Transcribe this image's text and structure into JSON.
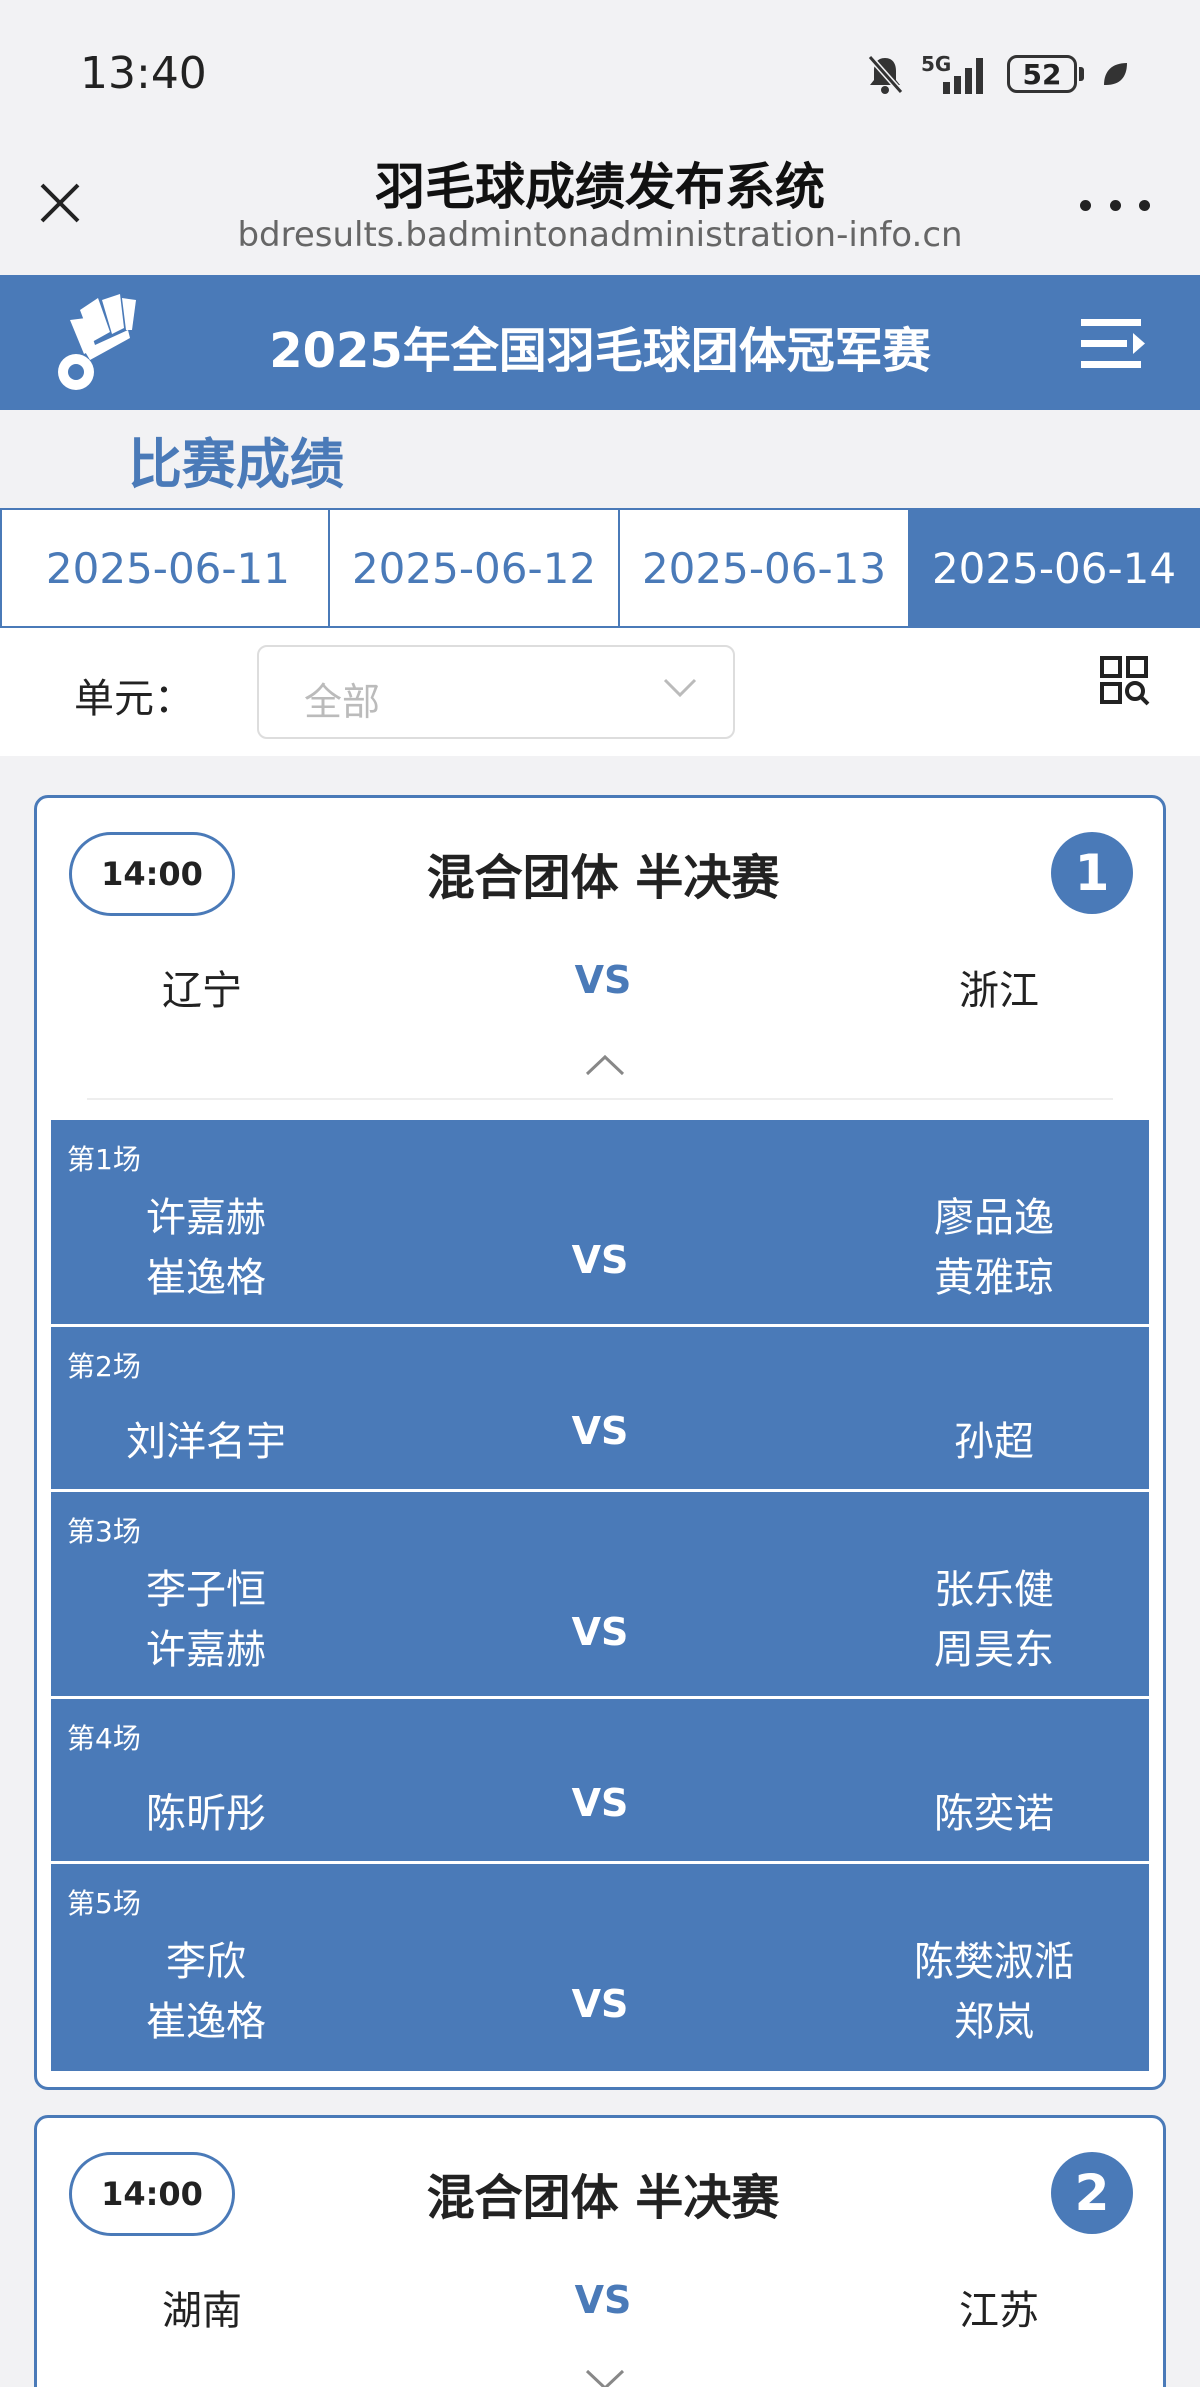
{
  "status_bar": {
    "time": "13:40",
    "network": "5G",
    "battery": "52"
  },
  "browser": {
    "title": "羽毛球成绩发布系统",
    "url": "bdresults.badmintonadministration-info.cn"
  },
  "site": {
    "title": "2025年全国羽毛球团体冠军赛"
  },
  "page": {
    "heading": "比赛成绩"
  },
  "dates": [
    "2025-06-11",
    "2025-06-12",
    "2025-06-13",
    "2025-06-14"
  ],
  "active_date": "2025-06-14",
  "filter": {
    "label": "单元：",
    "value": "全部"
  },
  "matches": [
    {
      "time": "14:00",
      "event": "混合团体 半决赛",
      "number": "1",
      "team_left": "辽宁",
      "vs": "VS",
      "team_right": "浙江",
      "games": [
        {
          "label": "第1场",
          "left": [
            "许嘉赫",
            "崔逸格"
          ],
          "right": [
            "廖品逸",
            "黄雅琼"
          ],
          "vs": "VS"
        },
        {
          "label": "第2场",
          "left": [
            "刘洋名宇"
          ],
          "right": [
            "孙超"
          ],
          "vs": "VS"
        },
        {
          "label": "第3场",
          "left": [
            "李子恒",
            "许嘉赫"
          ],
          "right": [
            "张乐健",
            "周昊东"
          ],
          "vs": "VS"
        },
        {
          "label": "第4场",
          "left": [
            "陈昕彤"
          ],
          "right": [
            "陈奕诺"
          ],
          "vs": "VS"
        },
        {
          "label": "第5场",
          "left": [
            "李欣",
            "崔逸格"
          ],
          "right": [
            "陈樊淑湉",
            "郑岚"
          ],
          "vs": "VS"
        }
      ]
    },
    {
      "time": "14:00",
      "event": "混合团体 半决赛",
      "number": "2",
      "team_left": "湖南",
      "vs": "VS",
      "team_right": "江苏"
    }
  ],
  "colors": {
    "accent": "#4a7ab8",
    "background": "#f2f2f4"
  }
}
